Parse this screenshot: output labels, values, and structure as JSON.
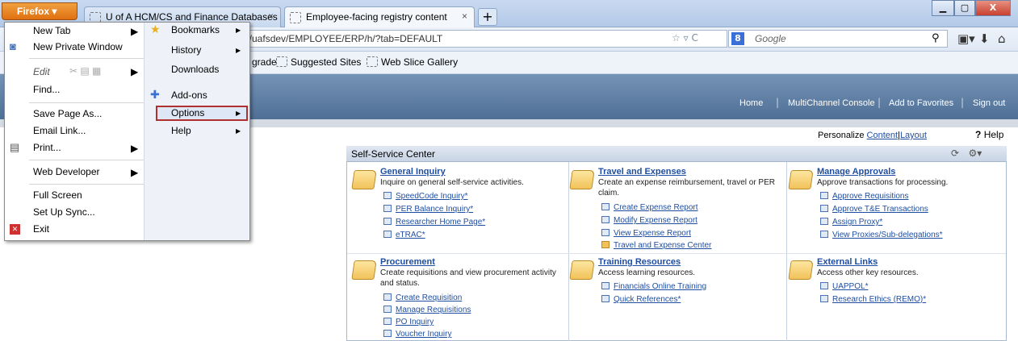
{
  "browser": {
    "menu_button": "Firefox",
    "tabs": [
      {
        "title": "U of A HCM/CS and Finance Databases",
        "close": "×"
      },
      {
        "title": "Employee-facing registry content",
        "close": "×"
      }
    ],
    "new_tab": "+",
    "url": "p/uafsdev/EMPLOYEE/ERP/h/?tab=DEFAULT",
    "search_placeholder": "Google",
    "search_engine_glyph": "8",
    "window_buttons": {
      "min": "▁",
      "max": "▢",
      "close": "X"
    }
  },
  "bookmarks_bar": [
    {
      "label": "grade"
    },
    {
      "label": "Suggested Sites"
    },
    {
      "label": "Web Slice Gallery"
    }
  ],
  "header_links": [
    "Home",
    "MultiChannel Console",
    "Add to Favorites",
    "Sign out"
  ],
  "personalize": {
    "label": "Personalize",
    "content": "Content",
    "divider": "|",
    "layout": "Layout"
  },
  "help": {
    "icon": "?",
    "label": "Help"
  },
  "panel": {
    "title": "Self-Service Center",
    "sections": [
      {
        "title": "General Inquiry",
        "desc": "Inquire on general self-service activities.",
        "links": [
          "SpeedCode Inquiry*",
          "PER Balance Inquiry*",
          "Researcher Home Page*",
          "eTRAC*"
        ]
      },
      {
        "title": "Travel and Expenses",
        "desc": "Create an expense reimbursement, travel or PER claim.",
        "links": [
          "Create Expense Report",
          "Modify Expense Report",
          "View Expense Report",
          "Travel and Expense Center"
        ]
      },
      {
        "title": "Manage Approvals",
        "desc": "Approve transactions for processing.",
        "links": [
          "Approve Requisitions",
          "Approve T&E Transactions",
          "Assign Proxy*",
          "View Proxies/Sub-delegations*"
        ]
      },
      {
        "title": "Procurement",
        "desc": "Create requisitions and view procurement activity and status.",
        "links": [
          "Create Requisition",
          "Manage Requisitions",
          "PO Inquiry",
          "Voucher Inquiry"
        ]
      },
      {
        "title": "Training Resources",
        "desc": "Access learning resources.",
        "links": [
          "Financials Online Training",
          "Quick References*"
        ]
      },
      {
        "title": "External Links",
        "desc": "Access other key resources.",
        "links": [
          "UAPPOL*",
          "Research Ethics (REMO)*"
        ]
      }
    ]
  },
  "firefox_menu": {
    "left": [
      {
        "label": "New Tab",
        "submenu": true
      },
      {
        "label": "New Private Window"
      },
      {
        "label": "Edit",
        "submenu": true
      },
      {
        "label": "Find..."
      },
      {
        "label": "Save Page As..."
      },
      {
        "label": "Email Link..."
      },
      {
        "label": "Print...",
        "submenu": true
      },
      {
        "label": "Web Developer",
        "submenu": true
      },
      {
        "label": "Full Screen"
      },
      {
        "label": "Set Up Sync..."
      },
      {
        "label": "Exit"
      }
    ],
    "right": [
      {
        "label": "Bookmarks",
        "submenu": true
      },
      {
        "label": "History",
        "submenu": true
      },
      {
        "label": "Downloads"
      },
      {
        "label": "Add-ons"
      },
      {
        "label": "Options",
        "submenu": true,
        "highlighted": true
      },
      {
        "label": "Help",
        "submenu": true
      }
    ]
  },
  "colors": {
    "banner": "#5a7aa0",
    "link": "#1f4ea1",
    "highlight_box": "#b03030",
    "firefox_button": "#e8801c"
  }
}
